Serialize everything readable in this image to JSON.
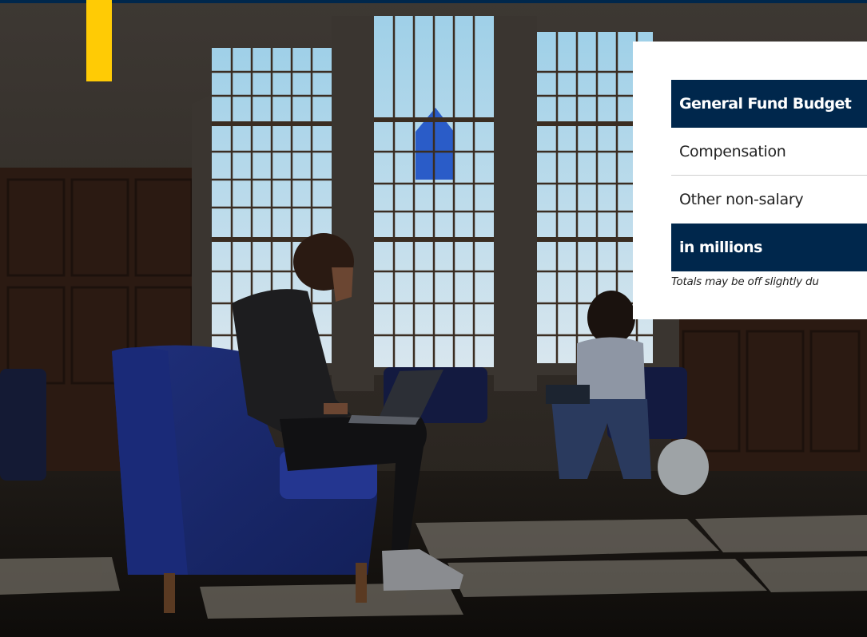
{
  "card": {
    "header": "General Fund Budget",
    "rows": [
      "Compensation",
      "Other non-salary"
    ],
    "units": "in millions",
    "footnote": "Totals may be off slightly du"
  },
  "colors": {
    "navy": "#00274c",
    "maize": "#ffcb05"
  },
  "photo": {
    "description_icon": "photo-image"
  }
}
